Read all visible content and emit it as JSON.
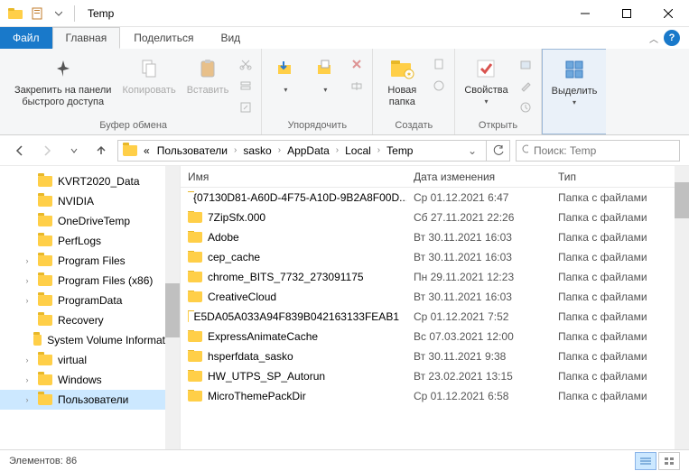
{
  "window": {
    "title": "Temp"
  },
  "tabs": {
    "file": "Файл",
    "items": [
      "Главная",
      "Поделиться",
      "Вид"
    ],
    "active_index": 0
  },
  "ribbon": {
    "groups": [
      {
        "label": "Буфер обмена",
        "buttons": [
          {
            "label": "Закрепить на панели\nбыстрого доступа",
            "icon": "pin"
          },
          {
            "label": "Копировать",
            "icon": "copy",
            "disabled": true
          },
          {
            "label": "Вставить",
            "icon": "paste",
            "disabled": true
          }
        ]
      },
      {
        "label": "Упорядочить",
        "buttons": [
          {
            "label": "",
            "icon": "moveto"
          },
          {
            "label": "",
            "icon": "copyto"
          }
        ]
      },
      {
        "label": "Создать",
        "buttons": [
          {
            "label": "Новая\nпапка",
            "icon": "newfolder"
          }
        ]
      },
      {
        "label": "Открыть",
        "buttons": [
          {
            "label": "Свойства",
            "icon": "properties"
          }
        ]
      },
      {
        "label": "",
        "buttons": [
          {
            "label": "Выделить",
            "icon": "select",
            "selected": true
          }
        ]
      }
    ]
  },
  "breadcrumb": {
    "segments": [
      "«",
      "Пользователи",
      "sasko",
      "AppData",
      "Local",
      "Temp"
    ]
  },
  "search": {
    "placeholder": "Поиск: Temp"
  },
  "tree": {
    "items": [
      {
        "label": "KVRT2020_Data"
      },
      {
        "label": "NVIDIA"
      },
      {
        "label": "OneDriveTemp"
      },
      {
        "label": "PerfLogs"
      },
      {
        "label": "Program Files",
        "expandable": true
      },
      {
        "label": "Program Files (x86)",
        "expandable": true
      },
      {
        "label": "ProgramData",
        "expandable": true
      },
      {
        "label": "Recovery"
      },
      {
        "label": "System Volume Information"
      },
      {
        "label": "virtual",
        "expandable": true
      },
      {
        "label": "Windows",
        "expandable": true
      },
      {
        "label": "Пользователи",
        "expandable": true,
        "selected": true
      }
    ]
  },
  "columns": {
    "name": "Имя",
    "date": "Дата изменения",
    "type": "Тип"
  },
  "rows": [
    {
      "name": "{07130D81-A60D-4F75-A10D-9B2A8F00D...",
      "date": "Ср 01.12.2021 6:47",
      "type": "Папка с файлами"
    },
    {
      "name": "7ZipSfx.000",
      "date": "Сб 27.11.2021 22:26",
      "type": "Папка с файлами"
    },
    {
      "name": "Adobe",
      "date": "Вт 30.11.2021 16:03",
      "type": "Папка с файлами"
    },
    {
      "name": "cep_cache",
      "date": "Вт 30.11.2021 16:03",
      "type": "Папка с файлами"
    },
    {
      "name": "chrome_BITS_7732_273091175",
      "date": "Пн 29.11.2021 12:23",
      "type": "Папка с файлами"
    },
    {
      "name": "CreativeCloud",
      "date": "Вт 30.11.2021 16:03",
      "type": "Папка с файлами"
    },
    {
      "name": "E5DA05A033A94F839B042163133FEAB1",
      "date": "Ср 01.12.2021 7:52",
      "type": "Папка с файлами"
    },
    {
      "name": "ExpressAnimateCache",
      "date": "Вс 07.03.2021 12:00",
      "type": "Папка с файлами"
    },
    {
      "name": "hsperfdata_sasko",
      "date": "Вт 30.11.2021 9:38",
      "type": "Папка с файлами"
    },
    {
      "name": "HW_UTPS_SP_Autorun",
      "date": "Вт 23.02.2021 13:15",
      "type": "Папка с файлами"
    },
    {
      "name": "MicroThemePackDir",
      "date": "Ср 01.12.2021 6:58",
      "type": "Папка с файлами"
    }
  ],
  "status": {
    "count_label": "Элементов:",
    "count": "86"
  }
}
